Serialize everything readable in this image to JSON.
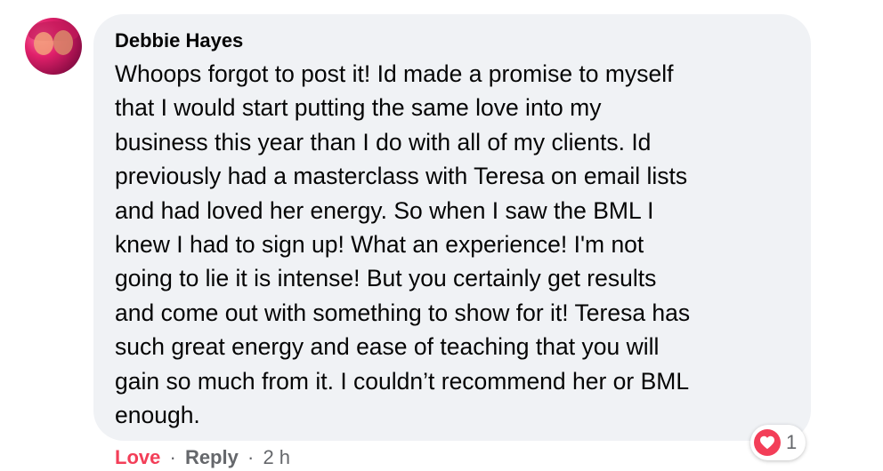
{
  "comment": {
    "author": "Debbie Hayes",
    "lines": [
      "Whoops forgot to post it! Id made a promise to myself",
      "that I would start putting the same love into my",
      "business this year than I do with all of my clients. Id",
      "previously had a masterclass with Teresa on email lists",
      "and had loved her energy. So when I saw the BML I",
      "knew I had to sign up! What an experience! I'm not",
      "going to lie it is intense! But you certainly get results",
      "and come out with something to show for it! Teresa has",
      "such great energy and ease of teaching that you will",
      "gain so much from it. I couldn’t recommend her or BML",
      "enough."
    ],
    "actions": {
      "love_label": "Love",
      "separator": "·",
      "reply_label": "Reply",
      "time": "2 h"
    },
    "reaction": {
      "icon": "heart-icon",
      "count": "1"
    }
  },
  "colors": {
    "bubble": "#f0f2f5",
    "love": "#f33e58",
    "muted": "#65676b",
    "text": "#050505"
  }
}
